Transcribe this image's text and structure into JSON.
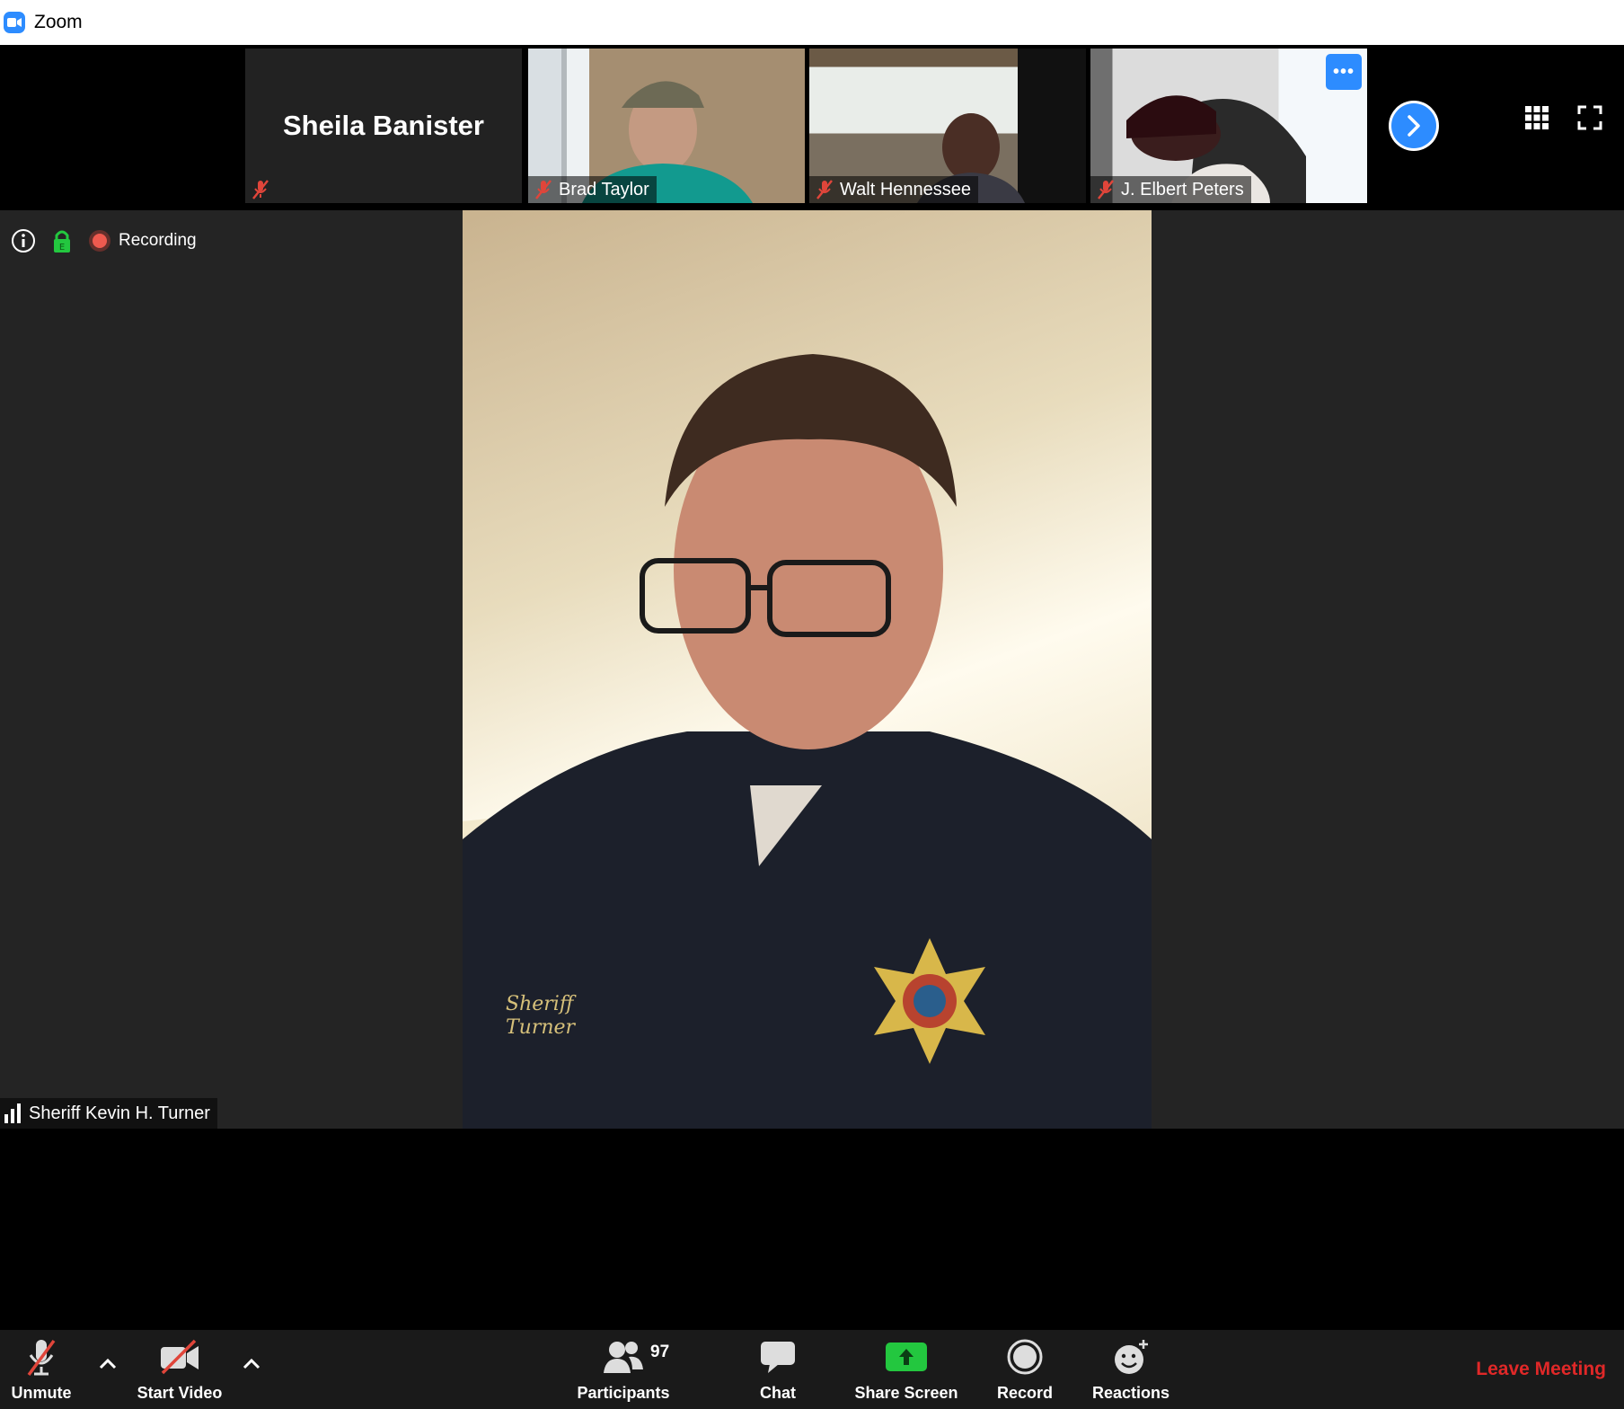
{
  "window": {
    "title": "Zoom"
  },
  "strip": {
    "tiles": [
      {
        "name": "Sheila Banister",
        "display_name": "Sheila Banister",
        "muted": true
      },
      {
        "name": "Brad Taylor",
        "muted": true
      },
      {
        "name": "Walt Hennessee",
        "muted": true
      },
      {
        "name": "J. Elbert Peters",
        "muted": true
      }
    ],
    "more_label": "•••"
  },
  "status": {
    "recording_label": "Recording"
  },
  "speaker": {
    "name": "Sheriff Kevin H. Turner"
  },
  "toolbar": {
    "unmute_label": "Unmute",
    "start_video_label": "Start Video",
    "participants_label": "Participants",
    "participants_count": "97",
    "chat_label": "Chat",
    "share_screen_label": "Share Screen",
    "record_label": "Record",
    "reactions_label": "Reactions",
    "leave_label": "Leave Meeting"
  },
  "colors": {
    "accent": "#2d8cff",
    "leave": "#e02828",
    "share": "#23c73f",
    "mute": "#e0453a"
  }
}
